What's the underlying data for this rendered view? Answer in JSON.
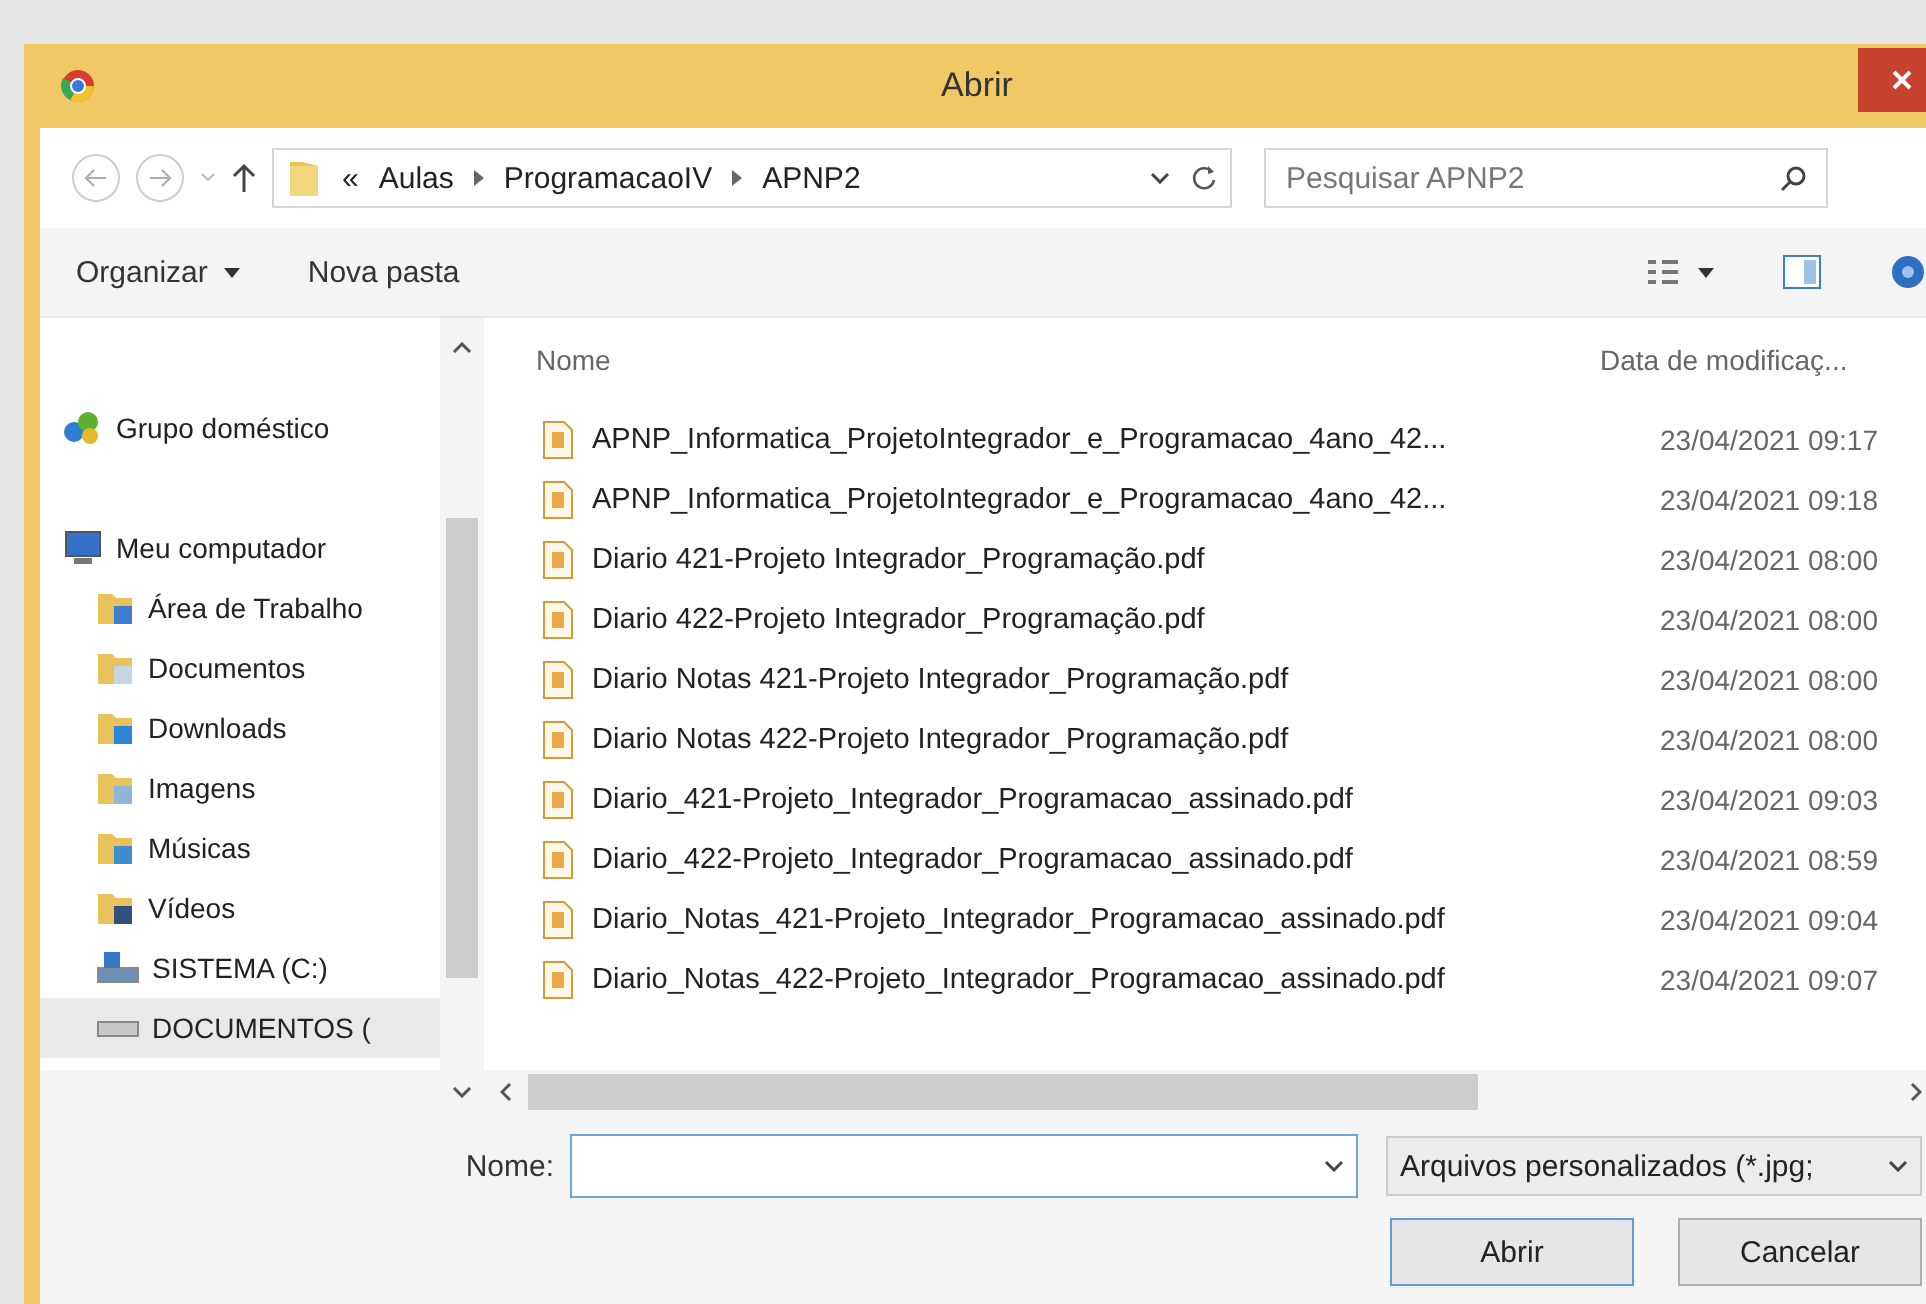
{
  "window": {
    "title": "Abrir"
  },
  "address": {
    "path": [
      {
        "label": "«"
      },
      {
        "label": "Aulas"
      },
      {
        "label": "ProgramacaoIV"
      },
      {
        "label": "APNP2"
      }
    ]
  },
  "search": {
    "placeholder": "Pesquisar APNP2"
  },
  "toolbar": {
    "items": [
      {
        "label": "Organizar",
        "dropdown": true
      },
      {
        "label": "Nova pasta",
        "dropdown": false
      }
    ]
  },
  "sidebar": {
    "items": [
      {
        "label": "Grupo doméstico",
        "kind": "homegroup",
        "selected": false
      },
      {
        "label": "Meu computador",
        "kind": "computer",
        "selected": false,
        "children": [
          {
            "label": "Área de Trabalho",
            "kind": "desktop",
            "selected": false
          },
          {
            "label": "Documentos",
            "kind": "documents",
            "selected": false
          },
          {
            "label": "Downloads",
            "kind": "downloads",
            "selected": false
          },
          {
            "label": "Imagens",
            "kind": "pictures",
            "selected": false
          },
          {
            "label": "Músicas",
            "kind": "music",
            "selected": false
          },
          {
            "label": "Vídeos",
            "kind": "videos",
            "selected": false
          },
          {
            "label": "SISTEMA (C:)",
            "kind": "system-drive",
            "selected": false
          },
          {
            "label": "DOCUMENTOS (",
            "kind": "drive",
            "selected": true
          }
        ]
      }
    ]
  },
  "table": {
    "columns": [
      "Nome",
      "Data de modificaç..."
    ],
    "rows": [
      {
        "name": "APNP_Informatica_ProjetoIntegrador_e_Programacao_4ano_42...",
        "date": "23/04/2021 09:17"
      },
      {
        "name": "APNP_Informatica_ProjetoIntegrador_e_Programacao_4ano_42...",
        "date": "23/04/2021 09:18"
      },
      {
        "name": "Diario 421-Projeto Integrador_Programação.pdf",
        "date": "23/04/2021 08:00"
      },
      {
        "name": "Diario 422-Projeto Integrador_Programação.pdf",
        "date": "23/04/2021 08:00"
      },
      {
        "name": "Diario Notas 421-Projeto Integrador_Programação.pdf",
        "date": "23/04/2021 08:00"
      },
      {
        "name": "Diario Notas 422-Projeto Integrador_Programação.pdf",
        "date": "23/04/2021 08:00"
      },
      {
        "name": "Diario_421-Projeto_Integrador_Programacao_assinado.pdf",
        "date": "23/04/2021 09:03"
      },
      {
        "name": "Diario_422-Projeto_Integrador_Programacao_assinado.pdf",
        "date": "23/04/2021 08:59"
      },
      {
        "name": "Diario_Notas_421-Projeto_Integrador_Programacao_assinado.pdf",
        "date": "23/04/2021 09:04"
      },
      {
        "name": "Diario_Notas_422-Projeto_Integrador_Programacao_assinado.pdf",
        "date": "23/04/2021 09:07"
      }
    ]
  },
  "footer": {
    "name_label": "Nome:",
    "file_type": "Arquivos personalizados (*.jpg;",
    "buttons": [
      "Abrir",
      "Cancelar"
    ]
  }
}
